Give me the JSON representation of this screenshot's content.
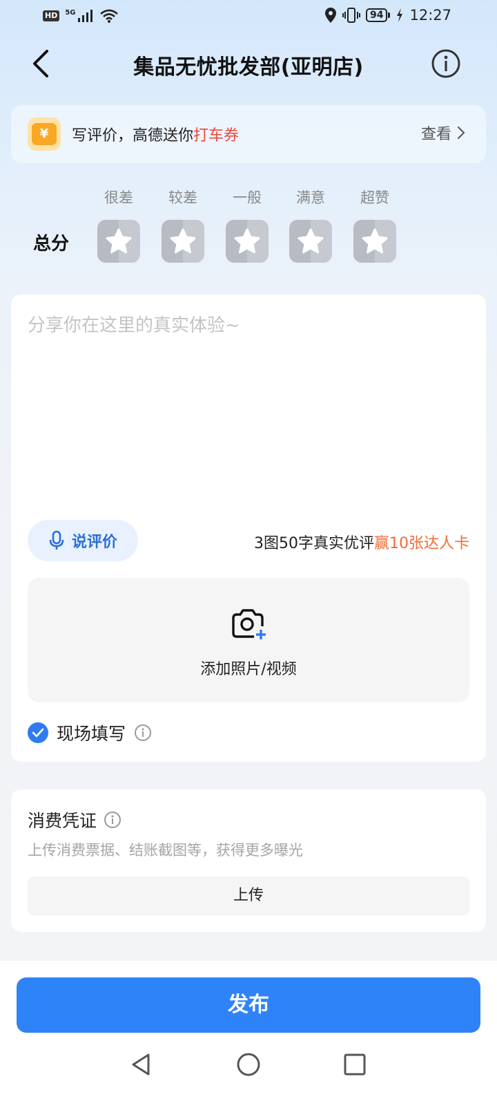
{
  "status_bar": {
    "hd": "HD",
    "network": "5G",
    "battery": "94",
    "time": "12:27"
  },
  "nav": {
    "title": "集品无忧批发部(亚明店)"
  },
  "promo": {
    "icon_symbol": "¥",
    "text_prefix": "写评价，高德送你",
    "text_highlight": "打车券",
    "view_label": "查看"
  },
  "rating": {
    "label": "总分",
    "options": [
      "很差",
      "较差",
      "一般",
      "满意",
      "超赞"
    ]
  },
  "review": {
    "placeholder": "分享你在这里的真实体验~",
    "voice_label": "说评价",
    "reward_prefix": "3图50字真实优评",
    "reward_highlight": "赢10张达人卡",
    "add_media_label": "添加照片/视频",
    "onsite_label": "现场填写",
    "onsite_checked": true
  },
  "proof": {
    "title": "消费凭证",
    "description": "上传消费票据、结账截图等，获得更多曝光",
    "upload_label": "上传"
  },
  "publish_label": "发布",
  "colors": {
    "accent_blue": "#2f83f8",
    "promo_red": "#f0473a",
    "reward_orange": "#f26b35"
  }
}
